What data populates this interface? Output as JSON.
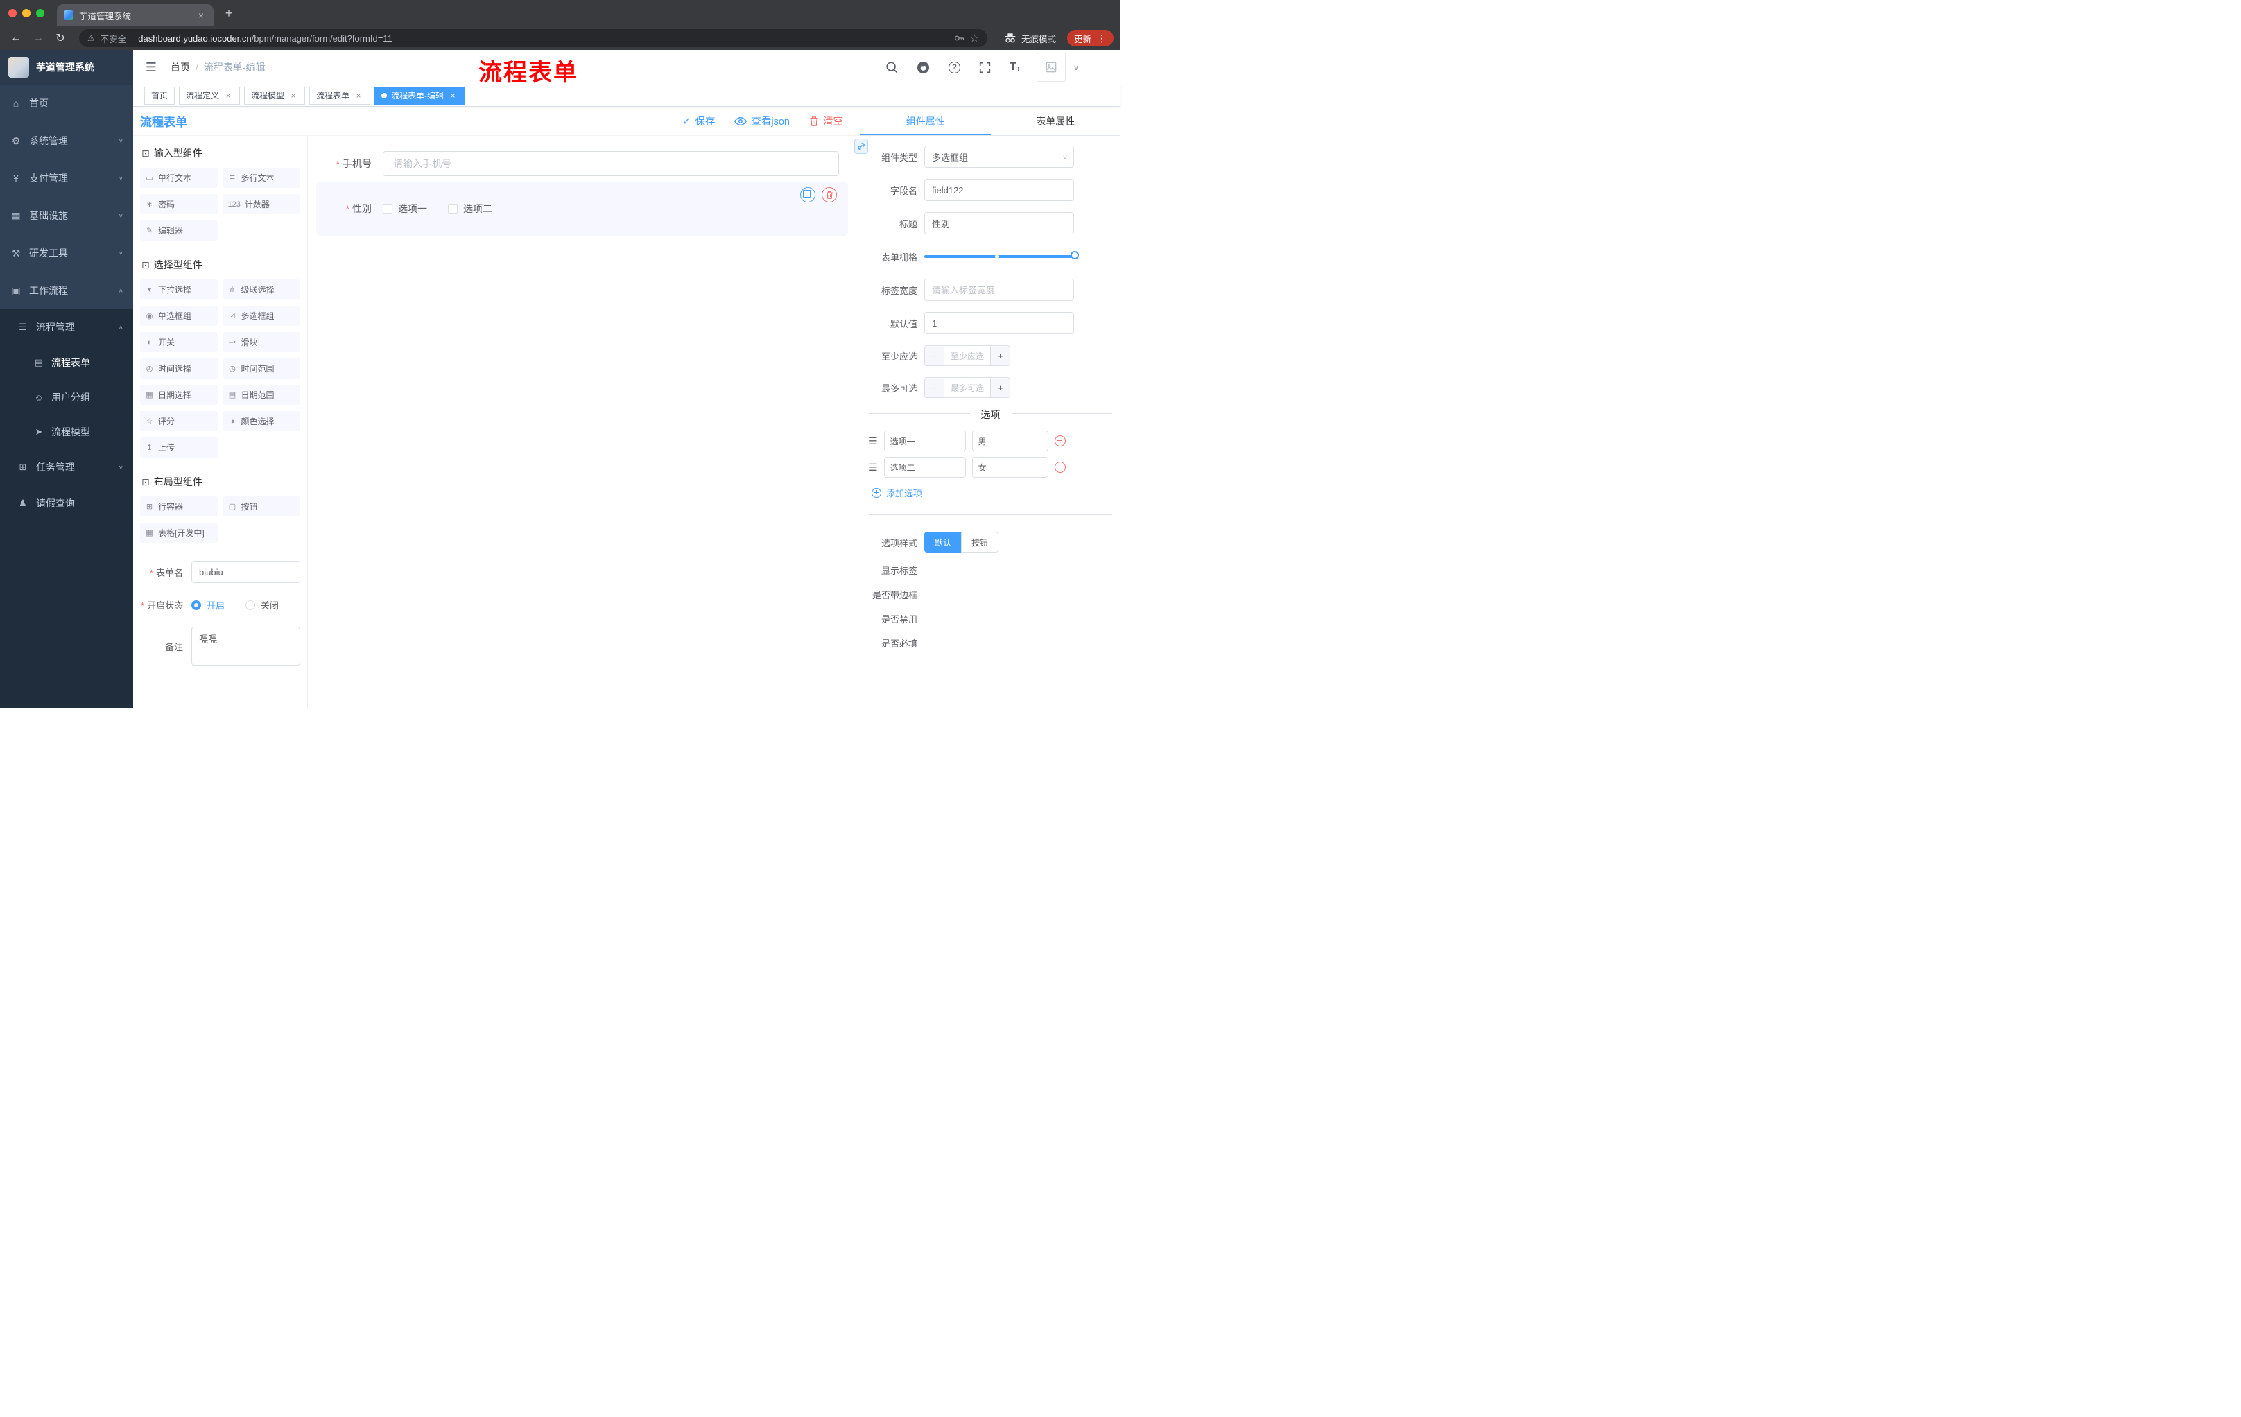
{
  "icons": {
    "close": "×",
    "new_tab": "+",
    "back": "←",
    "forward": "→",
    "reload": "↻",
    "warning": "⚠",
    "star": "☆",
    "more": "⋮",
    "hamburger": "☰",
    "caret_down": "∨",
    "caret_up": "∧",
    "check": "✓",
    "slash": "/",
    "question": "?"
  },
  "browser": {
    "tab_title": "芋道管理系统",
    "security": "不安全",
    "url_domain": "dashboard.yudao.iocoder.cn",
    "url_path": "/bpm/manager/form/edit?formId=11",
    "incognito": "无痕模式",
    "update": "更新"
  },
  "sidebar": {
    "logo": "芋道管理系统",
    "menu": [
      {
        "icon": "⌂",
        "label": "首页"
      },
      {
        "icon": "⚙",
        "label": "系统管理",
        "arrow": "∨"
      },
      {
        "icon": "¥",
        "label": "支付管理",
        "arrow": "∨"
      },
      {
        "icon": "▦",
        "label": "基础设施",
        "arrow": "∨"
      },
      {
        "icon": "⚒",
        "label": "研发工具",
        "arrow": "∨"
      },
      {
        "icon": "▣",
        "label": "工作流程",
        "arrow": "∧"
      }
    ],
    "submenu": [
      {
        "icon": "☰",
        "label": "流程管理",
        "arrow": "∧"
      },
      {
        "icon": "▤",
        "label": "流程表单"
      },
      {
        "icon": "☺",
        "label": "用户分组"
      },
      {
        "icon": "➤",
        "label": "流程模型"
      },
      {
        "icon": "⊞",
        "label": "任务管理",
        "arrow": "∨"
      },
      {
        "icon": "♟",
        "label": "请假查询"
      }
    ]
  },
  "navbar": {
    "breadcrumb_home": "首页",
    "breadcrumb_current": "流程表单-编辑",
    "watermark": "流程表单"
  },
  "tags": [
    {
      "label": "首页"
    },
    {
      "label": "流程定义"
    },
    {
      "label": "流程模型"
    },
    {
      "label": "流程表单"
    },
    {
      "label": "流程表单-编辑"
    }
  ],
  "designer": {
    "title": "流程表单",
    "actions": {
      "save": "保存",
      "view_json": "查看json",
      "clear": "清空"
    },
    "palette": {
      "sections": [
        {
          "icon": "⊡",
          "title": "输入型组件",
          "items": [
            {
              "icon": "▭",
              "label": "单行文本"
            },
            {
              "icon": "≣",
              "label": "多行文本"
            },
            {
              "icon": "∗",
              "label": "密码"
            },
            {
              "icon": "123",
              "label": "计数器"
            },
            {
              "icon": "✎",
              "label": "编辑器"
            }
          ]
        },
        {
          "icon": "⊡",
          "title": "选择型组件",
          "items": [
            {
              "icon": "▾",
              "label": "下拉选择"
            },
            {
              "icon": "⋔",
              "label": "级联选择"
            },
            {
              "icon": "◉",
              "label": "单选框组"
            },
            {
              "icon": "☑",
              "label": "多选框组"
            },
            {
              "icon": "◐",
              "label": "开关"
            },
            {
              "icon": "‒•",
              "label": "滑块"
            },
            {
              "icon": "◴",
              "label": "时间选择"
            },
            {
              "icon": "◷",
              "label": "时间范围"
            },
            {
              "icon": "▦",
              "label": "日期选择"
            },
            {
              "icon": "▤",
              "label": "日期范围"
            },
            {
              "icon": "☆",
              "label": "评分"
            },
            {
              "icon": "◑",
              "label": "颜色选择"
            },
            {
              "icon": "↥",
              "label": "上传"
            }
          ]
        },
        {
          "icon": "⊡",
          "title": "布局型组件",
          "items": [
            {
              "icon": "⊞",
              "label": "行容器"
            },
            {
              "icon": "▢",
              "label": "按钮"
            },
            {
              "icon": "▦",
              "label": "表格[开发中]"
            }
          ]
        }
      ],
      "form": {
        "name_label": "表单名",
        "name_value": "biubiu",
        "status_label": "开启状态",
        "status_on": "开启",
        "status_off": "关闭",
        "remark_label": "备注",
        "remark_value": "嘿嘿"
      }
    },
    "canvas": {
      "phone_label": "手机号",
      "phone_placeholder": "请输入手机号",
      "gender_label": "性别",
      "gender_options": [
        "选项一",
        "选项二"
      ]
    },
    "props": {
      "tab_component": "组件属性",
      "tab_form": "表单属性",
      "component_type_label": "组件类型",
      "component_type_value": "多选框组",
      "field_label": "字段名",
      "field_value": "field122",
      "title_label": "标题",
      "title_value": "性别",
      "grid_label": "表单栅格",
      "label_width_label": "标签宽度",
      "label_width_placeholder": "请输入标签宽度",
      "default_label": "默认值",
      "default_value": "1",
      "min_label": "至少应选",
      "min_placeholder": "至少应选",
      "max_label": "最多可选",
      "max_placeholder": "最多可选",
      "options_divider": "选项",
      "options": [
        {
          "label": "选项一",
          "value": "男"
        },
        {
          "label": "选项二",
          "value": "女"
        }
      ],
      "add_option": "添加选项",
      "style_label": "选项样式",
      "style_default": "默认",
      "style_button": "按钮",
      "switches": [
        {
          "label": "显示标签",
          "on": true
        },
        {
          "label": "是否带边框",
          "on": false
        },
        {
          "label": "是否禁用",
          "on": false
        },
        {
          "label": "是否必填",
          "on": true
        }
      ]
    }
  }
}
